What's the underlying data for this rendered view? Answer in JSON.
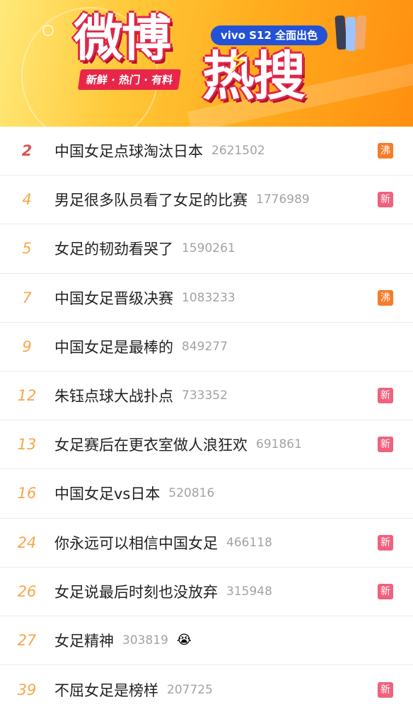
{
  "banner": {
    "logo_top": "微博",
    "logo_bottom": "热搜",
    "bolt_icon": "lightning-bolt-icon",
    "tagline": "新鲜 · 热门 · 有料",
    "sponsor": "vivo S12 全面出色"
  },
  "colors": {
    "rank_top": "#e05252",
    "rank_normal": "#f6a74a",
    "tag_hot": "#f57c2a",
    "tag_new": "#f0617d"
  },
  "items": [
    {
      "rank": "2",
      "title": "中国女足点球淘汰日本",
      "heat": "2621502",
      "tag": "沸"
    },
    {
      "rank": "4",
      "title": "男足很多队员看了女足的比赛",
      "heat": "1776989",
      "tag": "新"
    },
    {
      "rank": "5",
      "title": "女足的韧劲看哭了",
      "heat": "1590261",
      "tag": ""
    },
    {
      "rank": "7",
      "title": "中国女足晋级决赛",
      "heat": "1083233",
      "tag": "沸"
    },
    {
      "rank": "9",
      "title": "中国女足是最棒的",
      "heat": "849277",
      "tag": ""
    },
    {
      "rank": "12",
      "title": "朱钰点球大战扑点",
      "heat": "733352",
      "tag": "新"
    },
    {
      "rank": "13",
      "title": "女足赛后在更衣室做人浪狂欢",
      "heat": "691861",
      "tag": "新"
    },
    {
      "rank": "16",
      "title": "中国女足vs日本",
      "heat": "520816",
      "tag": ""
    },
    {
      "rank": "24",
      "title": "你永远可以相信中国女足",
      "heat": "466118",
      "tag": "新"
    },
    {
      "rank": "26",
      "title": "女足说最后时刻也没放弃",
      "heat": "315948",
      "tag": "新"
    },
    {
      "rank": "27",
      "title": "女足精神",
      "heat": "303819",
      "tag": "",
      "emoji": "😭"
    },
    {
      "rank": "39",
      "title": "不屈女足是榜样",
      "heat": "207725",
      "tag": "新"
    }
  ]
}
